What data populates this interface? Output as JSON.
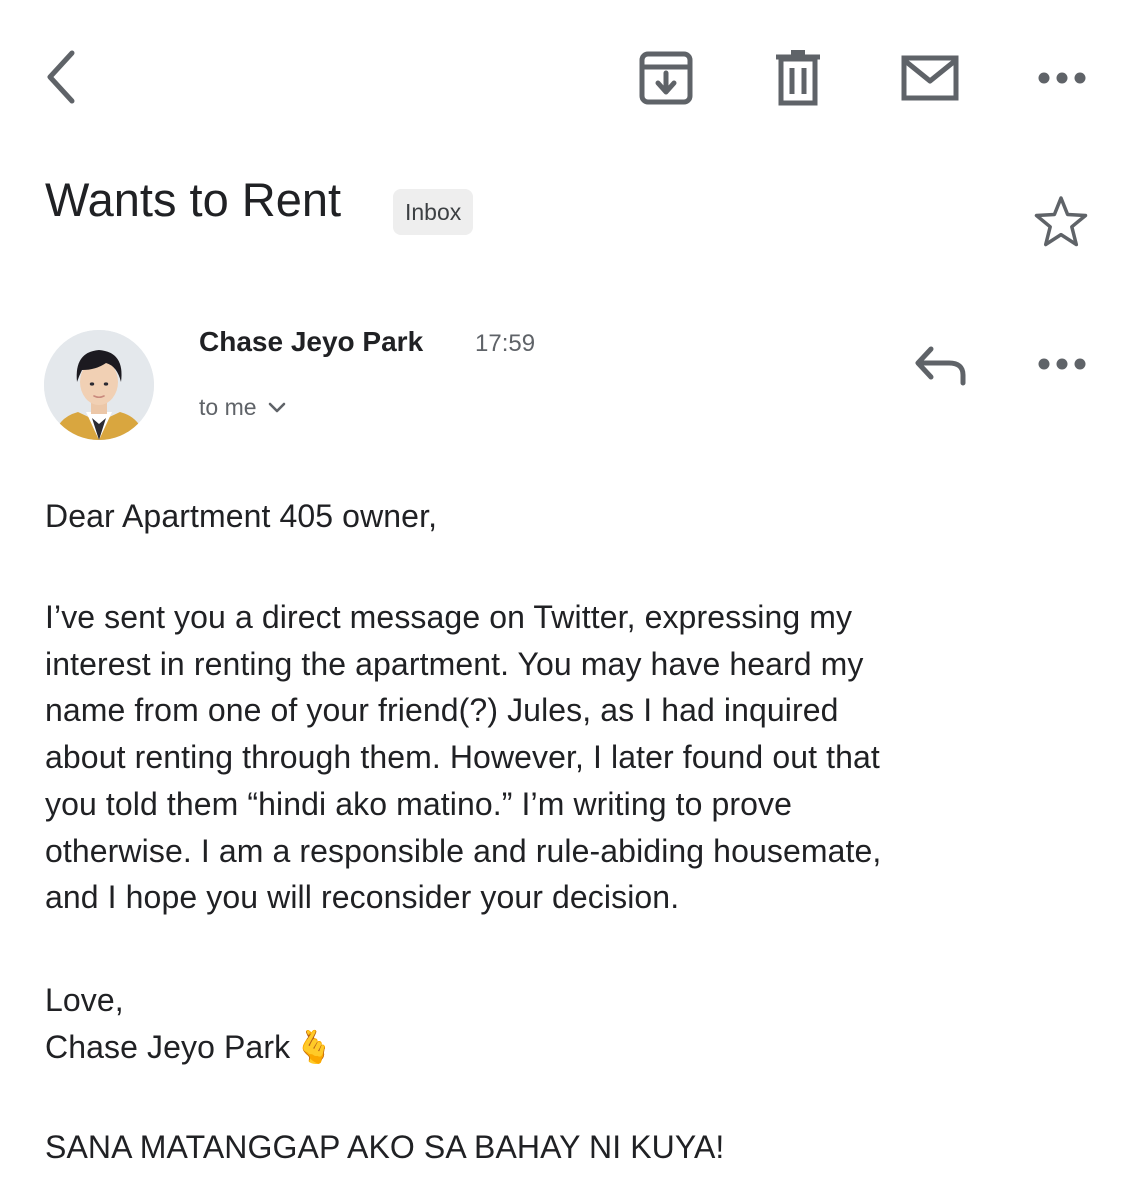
{
  "toolbar": {
    "back_icon": "chevron-left-icon",
    "archive_icon": "archive-icon",
    "delete_icon": "trash-icon",
    "mark_unread_icon": "envelope-icon",
    "more_icon": "more-horizontal-icon"
  },
  "email": {
    "subject": "Wants to Rent",
    "label": "Inbox",
    "starred": false,
    "sender": {
      "name": "Chase Jeyo Park",
      "time": "17:59",
      "recipient": "to me"
    },
    "body": {
      "greeting": "Dear Apartment 405 owner,",
      "lines": [
        "I’ve sent you a direct message on Twitter, expressing my",
        "interest in renting the apartment. You may have heard my",
        "name from one of your friend(?) Jules, as I had inquired",
        "about renting through them. However, I later found out that",
        "you told them “hindi ako matino.” I’m writing to prove",
        "otherwise. I am a responsible and rule-abiding housemate,",
        "and I hope you will reconsider your decision."
      ],
      "closing": "Love,",
      "signature": "Chase Jeyo Park",
      "signature_emoji": "🫰",
      "postscript": "SANA MATANGGAP AKO SA BAHAY NI KUYA!"
    }
  },
  "colors": {
    "icon": "#5f6368",
    "text": "#202124",
    "secondary_text": "#5f6368",
    "badge_bg": "#eeeeee"
  }
}
